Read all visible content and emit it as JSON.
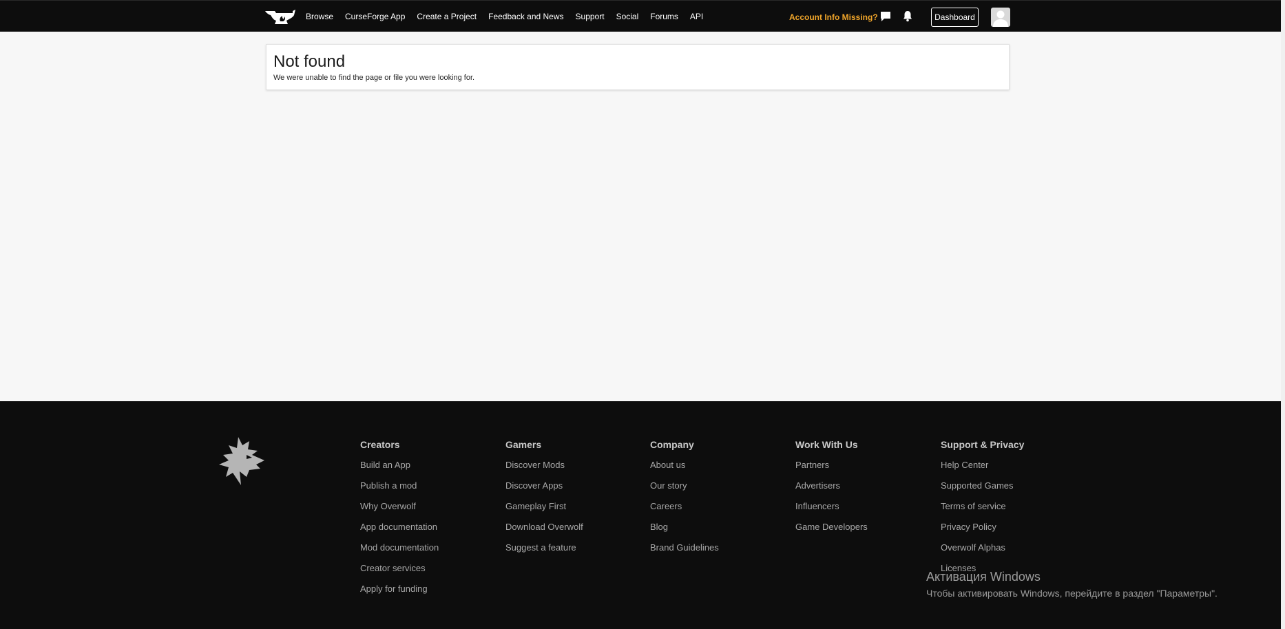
{
  "nav": {
    "items": [
      "Browse",
      "CurseForge App",
      "Create a Project",
      "Feedback and News",
      "Support",
      "Social",
      "Forums",
      "API"
    ],
    "account_missing": "Account Info Missing?",
    "dashboard": "Dashboard"
  },
  "main": {
    "title": "Not found",
    "message": "We were unable to find the page or file you were looking for."
  },
  "footer": {
    "columns": [
      {
        "heading": "Creators",
        "links": [
          "Build an App",
          "Publish a mod",
          "Why Overwolf",
          "App documentation",
          "Mod documentation",
          "Creator services",
          "Apply for funding"
        ]
      },
      {
        "heading": "Gamers",
        "links": [
          "Discover Mods",
          "Discover Apps",
          "Gameplay First",
          "Download Overwolf",
          "Suggest a feature"
        ]
      },
      {
        "heading": "Company",
        "links": [
          "About us",
          "Our story",
          "Careers",
          "Blog",
          "Brand Guidelines"
        ]
      },
      {
        "heading": "Work With Us",
        "links": [
          "Partners",
          "Advertisers",
          "Influencers",
          "Game Developers"
        ]
      },
      {
        "heading": "Support & Privacy",
        "links": [
          "Help Center",
          "Supported Games",
          "Terms of service",
          "Privacy Policy",
          "Overwolf Alphas",
          "Licenses"
        ]
      }
    ]
  },
  "windows_activation": {
    "title": "Активация Windows",
    "subtitle": "Чтобы активировать Windows, перейдите в раздел \"Параметры\"."
  },
  "colors": {
    "topbar": "#0d0d0d",
    "accent_warning": "#f0a52a",
    "page_bg": "#f7f7f7",
    "footer_bg": "#0d0d0d"
  }
}
